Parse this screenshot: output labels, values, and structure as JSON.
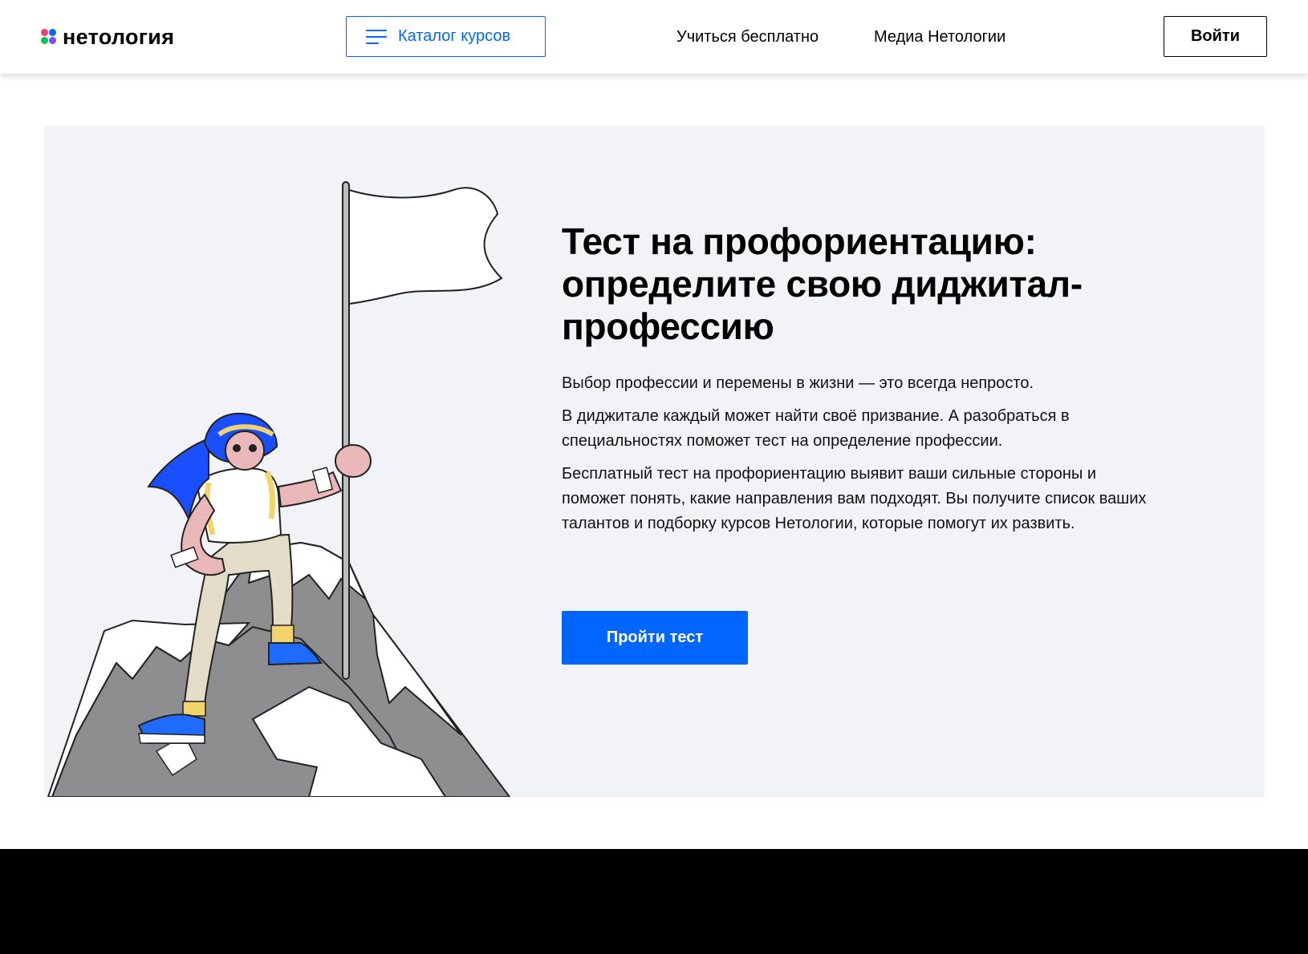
{
  "header": {
    "logo_text": "нетология",
    "catalog_label": "Каталог курсов",
    "nav": [
      {
        "label": "Учиться бесплатно"
      },
      {
        "label": "Медиа Нетологии"
      }
    ],
    "login_label": "Войти"
  },
  "hero": {
    "title": "Тест на профориентацию: определите свою диджитал-профессию",
    "paragraphs": [
      "Выбор профессии и перемены в жизни — это всегда непросто.",
      "В диджитале каждый может найти своё призвание. А разобраться в специальностях поможет тест на определение профессии.",
      "Бесплатный тест на профориентацию выявит ваши сильные стороны и поможет понять, какие направления вам подходят. Вы получите список ваших талантов и подборку курсов Нетологии, которые помогут их развить."
    ],
    "cta_label": "Пройти тест"
  },
  "colors": {
    "accent": "#0066ff",
    "hero_bg": "#f2f3f6",
    "footer_bg": "#000000",
    "logo_dots": [
      "#ff3b6b",
      "#0066ff",
      "#00c853",
      "#7c4dff"
    ]
  },
  "icons": {
    "logo": "netology-logo-icon",
    "catalog": "menu-burger-icon"
  }
}
